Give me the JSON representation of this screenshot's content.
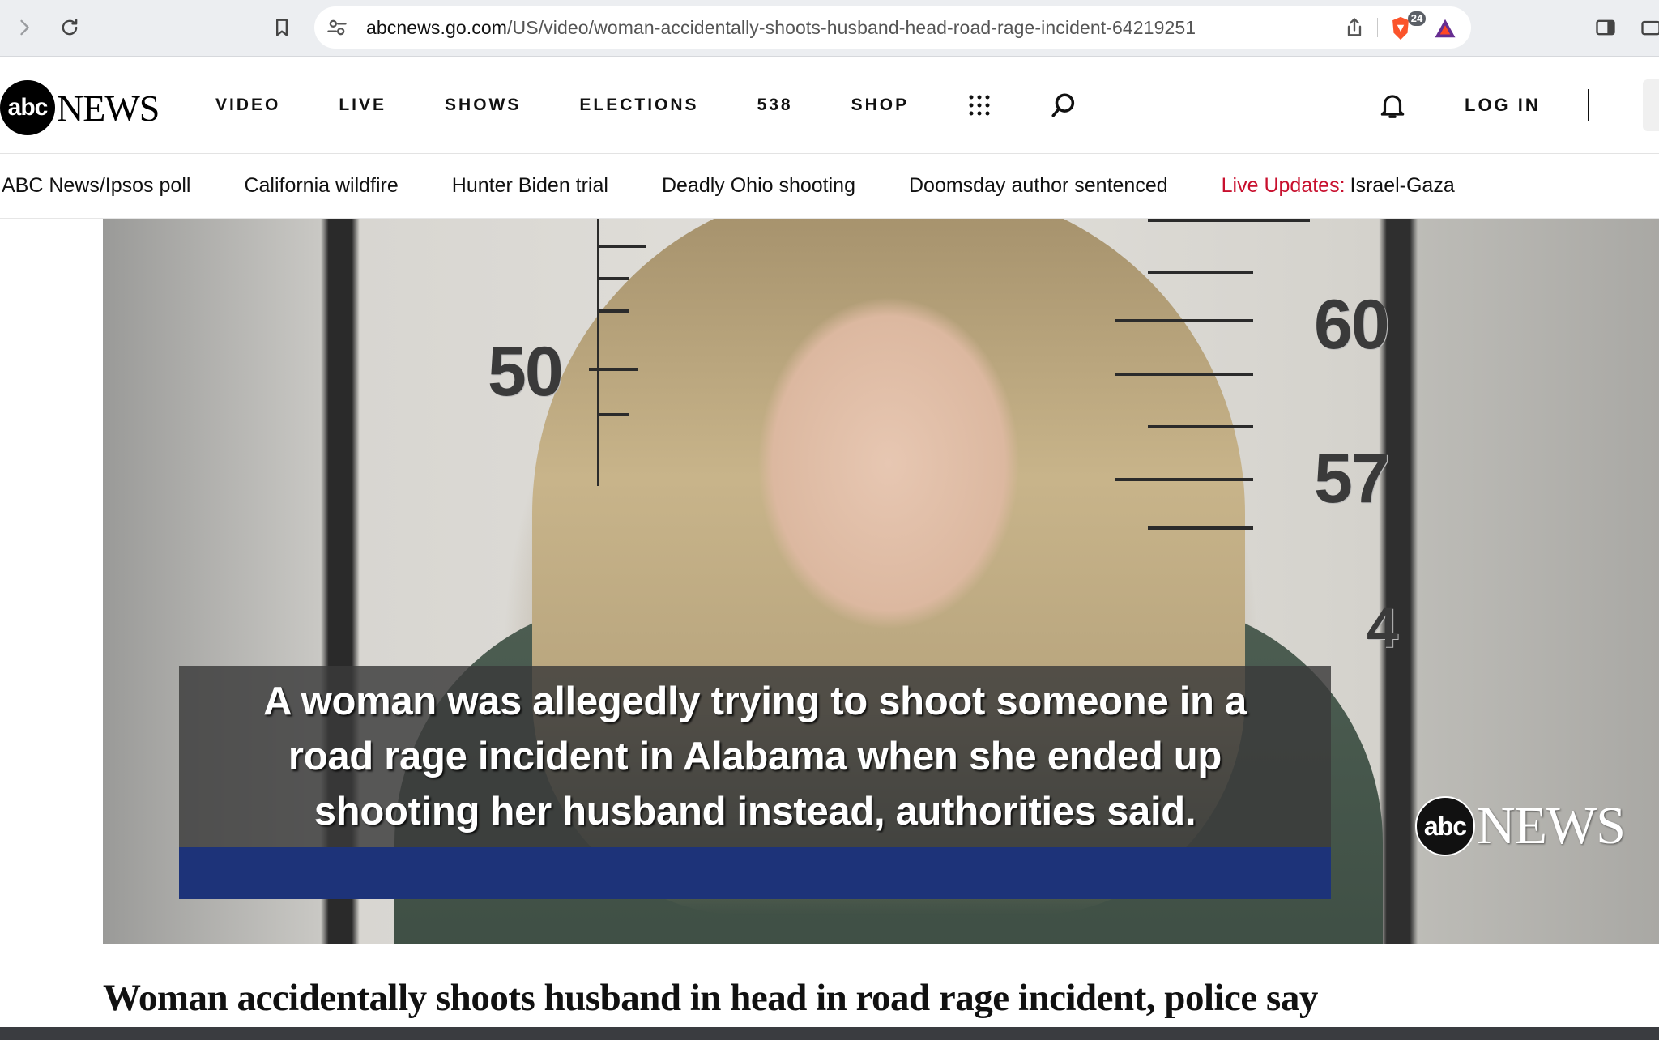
{
  "browser": {
    "url_host": "abcnews.go.com",
    "url_path": "/US/video/woman-accidentally-shoots-husband-head-road-rage-incident-64219251",
    "shields_badge": "24"
  },
  "header": {
    "logo_circle": "abc",
    "logo_text": "NEWS",
    "nav": [
      "VIDEO",
      "LIVE",
      "SHOWS",
      "ELECTIONS",
      "538",
      "SHOP"
    ],
    "login_label": "LOG IN"
  },
  "trending": {
    "items": [
      "ABC News/Ipsos poll",
      "California wildfire",
      "Hunter Biden trial",
      "Deadly Ohio shooting",
      "Doomsday author sentenced"
    ],
    "live_label": "Live Updates:",
    "live_topic": "Israel-Gaza"
  },
  "video": {
    "mugshot_numbers": [
      "50",
      "60",
      "57",
      "4"
    ],
    "caption_lines": [
      "A woman was allegedly trying to shoot someone in a",
      "road rage incident in Alabama when she ended up",
      "shooting her husband instead, authorities said."
    ],
    "watermark_circle": "abc",
    "watermark_text": "NEWS"
  },
  "article": {
    "headline": "Woman accidentally shoots husband in head in road rage incident, police say"
  }
}
